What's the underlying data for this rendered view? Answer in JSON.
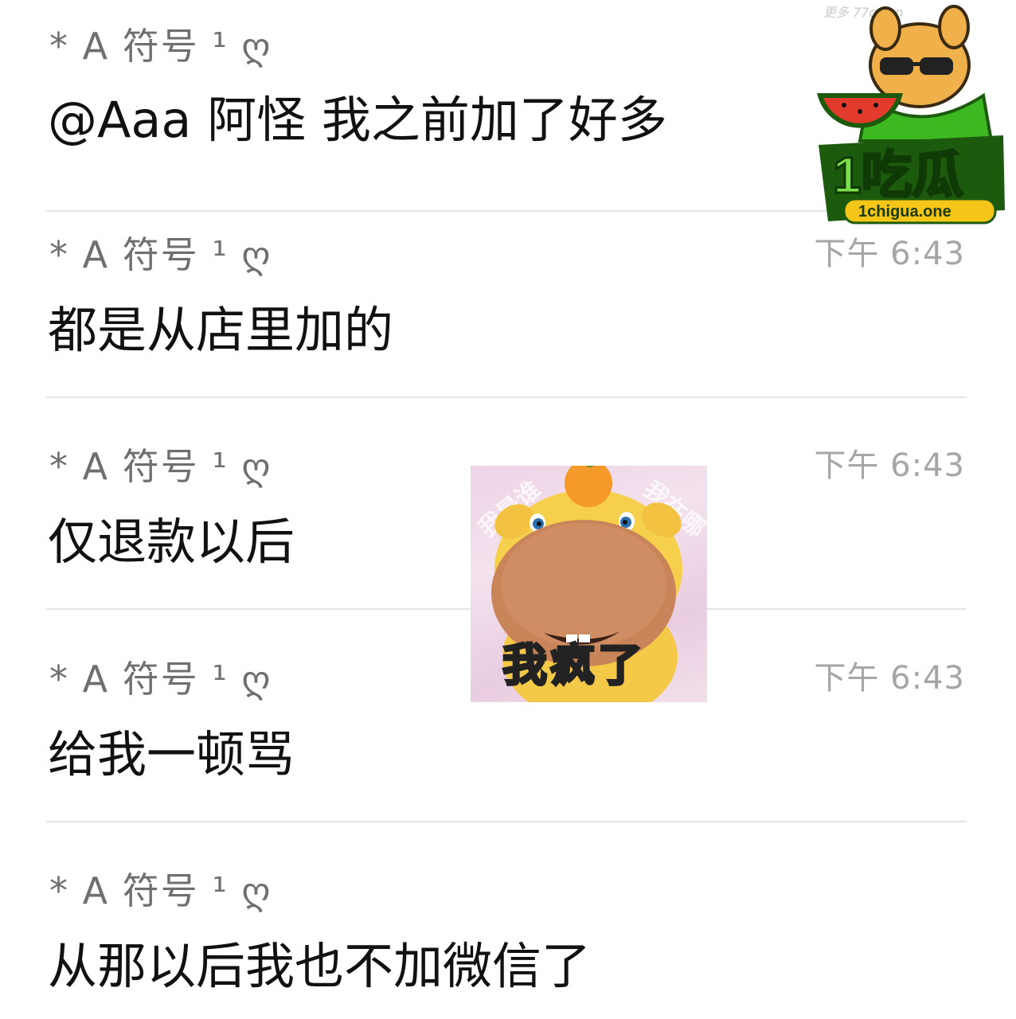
{
  "messages": [
    {
      "sender": "*   A 符号 ¹ ღ",
      "time": "",
      "text": "@Aaa 阿怪 我之前加了好多"
    },
    {
      "sender": "*   A 符号 ¹ ღ",
      "time": "下午 6:43",
      "text": "都是从店里加的"
    },
    {
      "sender": "*   A 符号 ¹ ღ",
      "time": "下午 6:43",
      "text": "仅退款以后"
    },
    {
      "sender": "*   A 符号 ¹ ღ",
      "time": "下午 6:43",
      "text": "给我一顿骂"
    },
    {
      "sender": "*   A 符号 ¹ ღ",
      "time": "",
      "text": "从那以后我也不加微信了"
    }
  ],
  "sticker": {
    "watermark_left": "我是谁",
    "watermark_right": "我在哪",
    "caption": "我疯了"
  },
  "logo": {
    "small_watermark": "更多 77cg.cn",
    "brand": "1吃瓜",
    "domain": "1chigua.one"
  },
  "colors": {
    "sender": "#6f6f6f",
    "time": "#a6a6a6",
    "text": "#111111",
    "divider": "#e5e5e5",
    "logo_green": "#3db820",
    "logo_yellow": "#f5c518"
  }
}
